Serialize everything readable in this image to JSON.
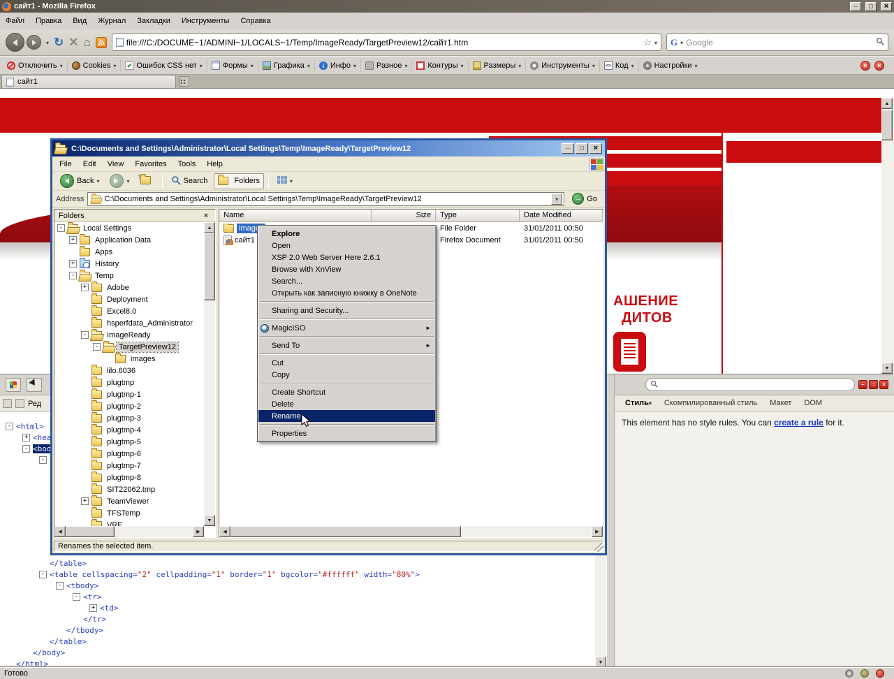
{
  "colors": {
    "accent_red": "#c80c10",
    "selection_blue": "#316ac5",
    "menu_highlight": "#0a246a"
  },
  "firefox": {
    "title": "сайт1 - Mozilla Firefox",
    "menu_items": [
      "Файл",
      "Правка",
      "Вид",
      "Журнал",
      "Закладки",
      "Инструменты",
      "Справка"
    ],
    "url": "file:///C:/DOCUME~1/ADMINI~1/LOCALS~1/Temp/ImageReady/TargetPreview12/сайт1.htm",
    "search_placeholder": "Google",
    "tab_label": "сайт1",
    "status_text": "Готово"
  },
  "webdev_toolbar": {
    "items": [
      {
        "icon": "disable-icon",
        "label": "Отключить"
      },
      {
        "icon": "cookies-icon",
        "label": "Cookies"
      },
      {
        "icon": "css-icon",
        "label": "Ошибок CSS нет"
      },
      {
        "icon": "forms-icon",
        "label": "Формы"
      },
      {
        "icon": "images-icon",
        "label": "Графика"
      },
      {
        "icon": "info-icon",
        "label": "Инфо"
      },
      {
        "icon": "misc-icon",
        "label": "Разное"
      },
      {
        "icon": "outline-icon",
        "label": "Контуры"
      },
      {
        "icon": "resize-icon",
        "label": "Размеры"
      },
      {
        "icon": "tools-icon",
        "label": "Инструменты"
      },
      {
        "icon": "code-icon",
        "label": "Код"
      },
      {
        "icon": "options-icon",
        "label": "Настройки"
      }
    ]
  },
  "page": {
    "headline_line1": "АШЕНИЕ",
    "headline_line2": "ДИТОВ"
  },
  "explorer": {
    "title": "C:\\Documents and Settings\\Administrator\\Local Settings\\Temp\\ImageReady\\TargetPreview12",
    "menu_items": [
      "File",
      "Edit",
      "View",
      "Favorites",
      "Tools",
      "Help"
    ],
    "toolbar": {
      "back_label": "Back",
      "search_label": "Search",
      "folders_label": "Folders"
    },
    "address_label": "Address",
    "address_value": "C:\\Documents and Settings\\Administrator\\Local Settings\\Temp\\ImageReady\\TargetPreview12",
    "go_label": "Go",
    "folders_panel_title": "Folders",
    "tree": [
      {
        "label": "Local Settings",
        "depth": 0,
        "expander": "-",
        "icon": "folder-open"
      },
      {
        "label": "Application Data",
        "depth": 1,
        "expander": "+",
        "icon": "folder"
      },
      {
        "label": "Apps",
        "depth": 1,
        "expander": "",
        "icon": "folder"
      },
      {
        "label": "History",
        "depth": 1,
        "expander": "+",
        "icon": "history"
      },
      {
        "label": "Temp",
        "depth": 1,
        "expander": "-",
        "icon": "folder-open"
      },
      {
        "label": "Adobe",
        "depth": 2,
        "expander": "+",
        "icon": "folder"
      },
      {
        "label": "Deployment",
        "depth": 2,
        "expander": "",
        "icon": "folder"
      },
      {
        "label": "Excel8.0",
        "depth": 2,
        "expander": "",
        "icon": "folder"
      },
      {
        "label": "hsperfdata_Administrator",
        "depth": 2,
        "expander": "",
        "icon": "folder"
      },
      {
        "label": "ImageReady",
        "depth": 2,
        "expander": "-",
        "icon": "folder-open"
      },
      {
        "label": "TargetPreview12",
        "depth": 3,
        "expander": "-",
        "icon": "folder-open",
        "current": true
      },
      {
        "label": "images",
        "depth": 4,
        "expander": "",
        "icon": "folder"
      },
      {
        "label": "lilo.6036",
        "depth": 2,
        "expander": "",
        "icon": "folder"
      },
      {
        "label": "plugtmp",
        "depth": 2,
        "expander": "",
        "icon": "folder"
      },
      {
        "label": "plugtmp-1",
        "depth": 2,
        "expander": "",
        "icon": "folder"
      },
      {
        "label": "plugtmp-2",
        "depth": 2,
        "expander": "",
        "icon": "folder"
      },
      {
        "label": "plugtmp-3",
        "depth": 2,
        "expander": "",
        "icon": "folder"
      },
      {
        "label": "plugtmp-4",
        "depth": 2,
        "expander": "",
        "icon": "folder"
      },
      {
        "label": "plugtmp-5",
        "depth": 2,
        "expander": "",
        "icon": "folder"
      },
      {
        "label": "plugtmp-6",
        "depth": 2,
        "expander": "",
        "icon": "folder"
      },
      {
        "label": "plugtmp-7",
        "depth": 2,
        "expander": "",
        "icon": "folder"
      },
      {
        "label": "plugtmp-8",
        "depth": 2,
        "expander": "",
        "icon": "folder"
      },
      {
        "label": "SIT22062.tmp",
        "depth": 2,
        "expander": "",
        "icon": "folder"
      },
      {
        "label": "TeamViewer",
        "depth": 2,
        "expander": "+",
        "icon": "folder"
      },
      {
        "label": "TFSTemp",
        "depth": 2,
        "expander": "",
        "icon": "folder"
      },
      {
        "label": "VRF",
        "depth": 2,
        "expander": "",
        "icon": "folder"
      }
    ],
    "columns": [
      "Name",
      "Size",
      "Type",
      "Date Modified"
    ],
    "files": [
      {
        "name": "images",
        "size": "",
        "type": "File Folder",
        "date": "31/01/2011 00:50",
        "icon": "folder",
        "selected": true
      },
      {
        "name": "сайт1",
        "size": "",
        "type": "Firefox Document",
        "date": "31/01/2011 00:50",
        "icon": "firefox-doc",
        "selected": false
      }
    ],
    "status_text": "Renames the selected item."
  },
  "context_menu": {
    "items": [
      {
        "label": "Explore",
        "bold": true
      },
      {
        "label": "Open"
      },
      {
        "label": "XSP 2.0 Web Server Here 2.6.1"
      },
      {
        "label": "Browse with XnView"
      },
      {
        "label": "Search..."
      },
      {
        "label": "Открыть как записную книжку в OneNote"
      },
      {
        "separator": true
      },
      {
        "label": "Sharing and Security..."
      },
      {
        "separator": true
      },
      {
        "label": "MagicISO",
        "icon": "magiciso-icon",
        "submenu": true
      },
      {
        "separator": true
      },
      {
        "label": "Send To",
        "submenu": true
      },
      {
        "separator": true
      },
      {
        "label": "Cut"
      },
      {
        "label": "Copy"
      },
      {
        "separator": true
      },
      {
        "label": "Create Shortcut"
      },
      {
        "label": "Delete"
      },
      {
        "label": "Rename",
        "highlighted": true
      },
      {
        "separator": true
      },
      {
        "label": "Properties"
      }
    ]
  },
  "inspector": {
    "edit_label": "Ред",
    "html_nodes_top": [
      {
        "depth": 0,
        "expander": "-",
        "parts": [
          {
            "t": "tag",
            "v": "<html>"
          }
        ]
      },
      {
        "depth": 1,
        "expander": "+",
        "parts": [
          {
            "t": "tag",
            "v": "<head>"
          }
        ]
      },
      {
        "depth": 1,
        "expander": "-",
        "parts": [
          {
            "t": "tag",
            "v": "<body"
          }
        ],
        "selected": true
      },
      {
        "depth": 2,
        "expander": "-",
        "parts": []
      }
    ],
    "html_nodes_bottom": [
      {
        "depth": 2,
        "expander": "",
        "parts": [
          {
            "t": "tag",
            "v": "</table>"
          }
        ]
      },
      {
        "depth": 2,
        "expander": "-",
        "parts": [
          {
            "t": "tag",
            "v": "<table"
          },
          {
            "t": "attr",
            "v": " cellspacing="
          },
          {
            "t": "val",
            "v": "\"2\""
          },
          {
            "t": "attr",
            "v": " cellpadding="
          },
          {
            "t": "val",
            "v": "\"1\""
          },
          {
            "t": "attr",
            "v": " border="
          },
          {
            "t": "val",
            "v": "\"1\""
          },
          {
            "t": "attr",
            "v": " bgcolor="
          },
          {
            "t": "val",
            "v": "\"#ffffff\""
          },
          {
            "t": "attr",
            "v": " width="
          },
          {
            "t": "val",
            "v": "\"80%\""
          },
          {
            "t": "tag",
            "v": ">"
          }
        ]
      },
      {
        "depth": 3,
        "expander": "-",
        "parts": [
          {
            "t": "tag",
            "v": "<tbody>"
          }
        ]
      },
      {
        "depth": 4,
        "expander": "-",
        "parts": [
          {
            "t": "tag",
            "v": "<tr>"
          }
        ]
      },
      {
        "depth": 5,
        "expander": "+",
        "parts": [
          {
            "t": "tag",
            "v": "<td>"
          }
        ]
      },
      {
        "depth": 4,
        "expander": "",
        "parts": [
          {
            "t": "tag",
            "v": "</tr>"
          }
        ]
      },
      {
        "depth": 3,
        "expander": "",
        "parts": [
          {
            "t": "tag",
            "v": "</tbody>"
          }
        ]
      },
      {
        "depth": 2,
        "expander": "",
        "parts": [
          {
            "t": "tag",
            "v": "</table>"
          }
        ]
      },
      {
        "depth": 1,
        "expander": "",
        "parts": [
          {
            "t": "tag",
            "v": "</body>"
          }
        ]
      },
      {
        "depth": 0,
        "expander": "",
        "parts": [
          {
            "t": "tag",
            "v": "</html>"
          }
        ]
      }
    ],
    "style_tabs": [
      {
        "label": "Стиль",
        "active": true,
        "caret": true
      },
      {
        "label": "Скомпилированный стиль"
      },
      {
        "label": "Макет"
      },
      {
        "label": "DOM"
      }
    ],
    "no_rules": {
      "before": "This element has no style rules. You can ",
      "link": "create a rule",
      "after": " for it."
    }
  }
}
